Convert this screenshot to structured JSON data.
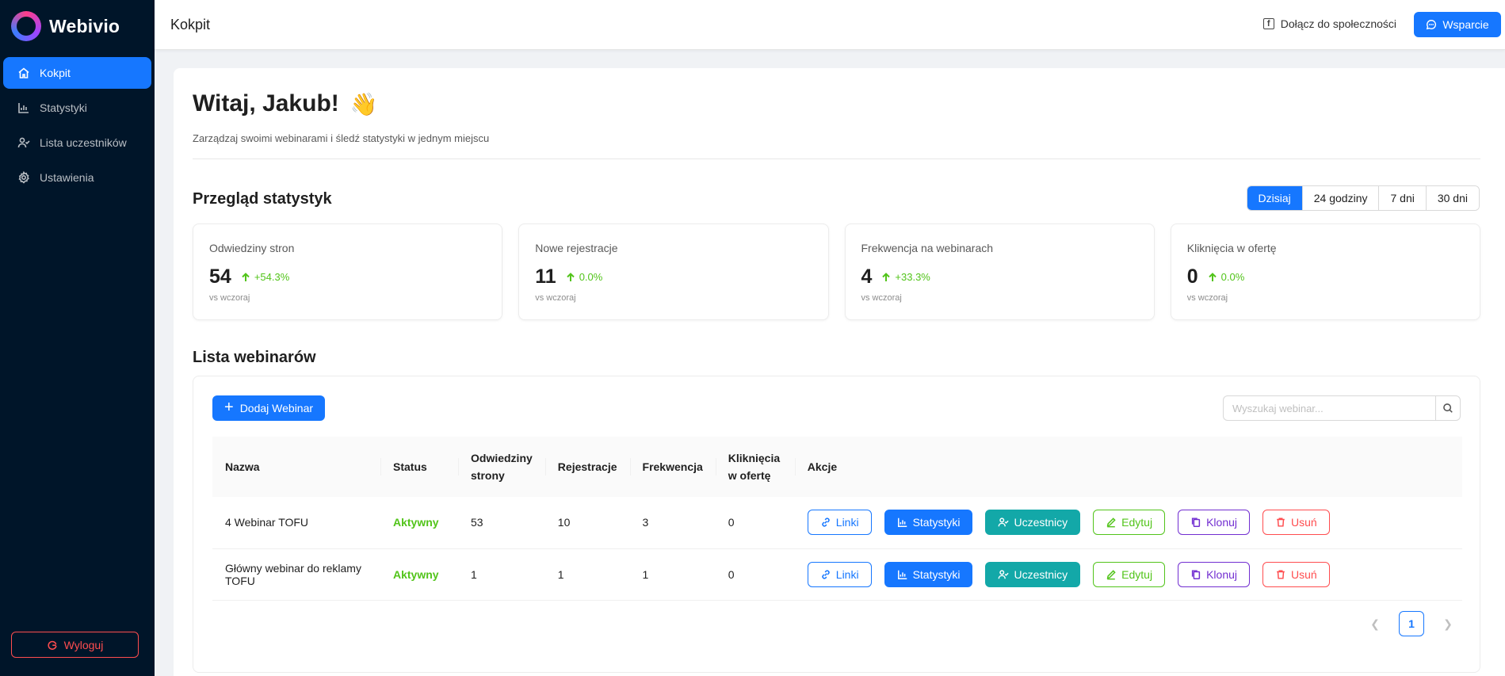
{
  "brand": {
    "name": "Webivio"
  },
  "sidebar": {
    "items": [
      {
        "label": "Kokpit",
        "icon": "home-icon",
        "active": true
      },
      {
        "label": "Statystyki",
        "icon": "bar-chart-icon"
      },
      {
        "label": "Lista uczestników",
        "icon": "users-icon"
      },
      {
        "label": "Ustawienia",
        "icon": "gear-icon"
      }
    ],
    "logout_label": "Wyloguj"
  },
  "header": {
    "title": "Kokpit",
    "community_label": "Dołącz do społeczności",
    "support_label": "Wsparcie"
  },
  "welcome": {
    "title": "Witaj, Jakub!",
    "emoji": "👋",
    "subtitle": "Zarządzaj swoimi webinarami i śledź statystyki w jednym miejscu"
  },
  "overview": {
    "title": "Przegląd statystyk",
    "periods": [
      "Dzisiaj",
      "24 godziny",
      "7 dni",
      "30 dni"
    ],
    "selected_period": "Dzisiaj",
    "cards": [
      {
        "label": "Odwiedziny stron",
        "value": "54",
        "change": "+54.3%",
        "compare": "vs wczoraj"
      },
      {
        "label": "Nowe rejestracje",
        "value": "11",
        "change": "0.0%",
        "compare": "vs wczoraj"
      },
      {
        "label": "Frekwencja na webinarach",
        "value": "4",
        "change": "+33.3%",
        "compare": "vs wczoraj"
      },
      {
        "label": "Kliknięcia w ofertę",
        "value": "0",
        "change": "0.0%",
        "compare": "vs wczoraj"
      }
    ]
  },
  "webinars": {
    "title": "Lista webinarów",
    "add_label": "Dodaj Webinar",
    "search_placeholder": "Wyszukaj webinar...",
    "columns": [
      "Nazwa",
      "Status",
      "Odwiedziny strony",
      "Rejestracje",
      "Frekwencja",
      "Kliknięcia w ofertę",
      "Akcje"
    ],
    "rows": [
      {
        "name": "4 Webinar TOFU",
        "status": "Aktywny",
        "visits": "53",
        "registrations": "10",
        "attendance": "3",
        "clicks": "0"
      },
      {
        "name": "Główny webinar do reklamy TOFU",
        "status": "Aktywny",
        "visits": "1",
        "registrations": "1",
        "attendance": "1",
        "clicks": "0"
      }
    ],
    "actions": {
      "links": "Linki",
      "stats": "Statystyki",
      "participants": "Uczestnicy",
      "edit": "Edytuj",
      "clone": "Klonuj",
      "delete": "Usuń"
    },
    "pagination": {
      "current_page": "1"
    }
  },
  "colors": {
    "sidebar_bg": "#001529",
    "primary": "#1677ff",
    "success": "#52c41a",
    "teal": "#13a8a8",
    "purple": "#722ed1",
    "danger": "#ff4d4f"
  }
}
